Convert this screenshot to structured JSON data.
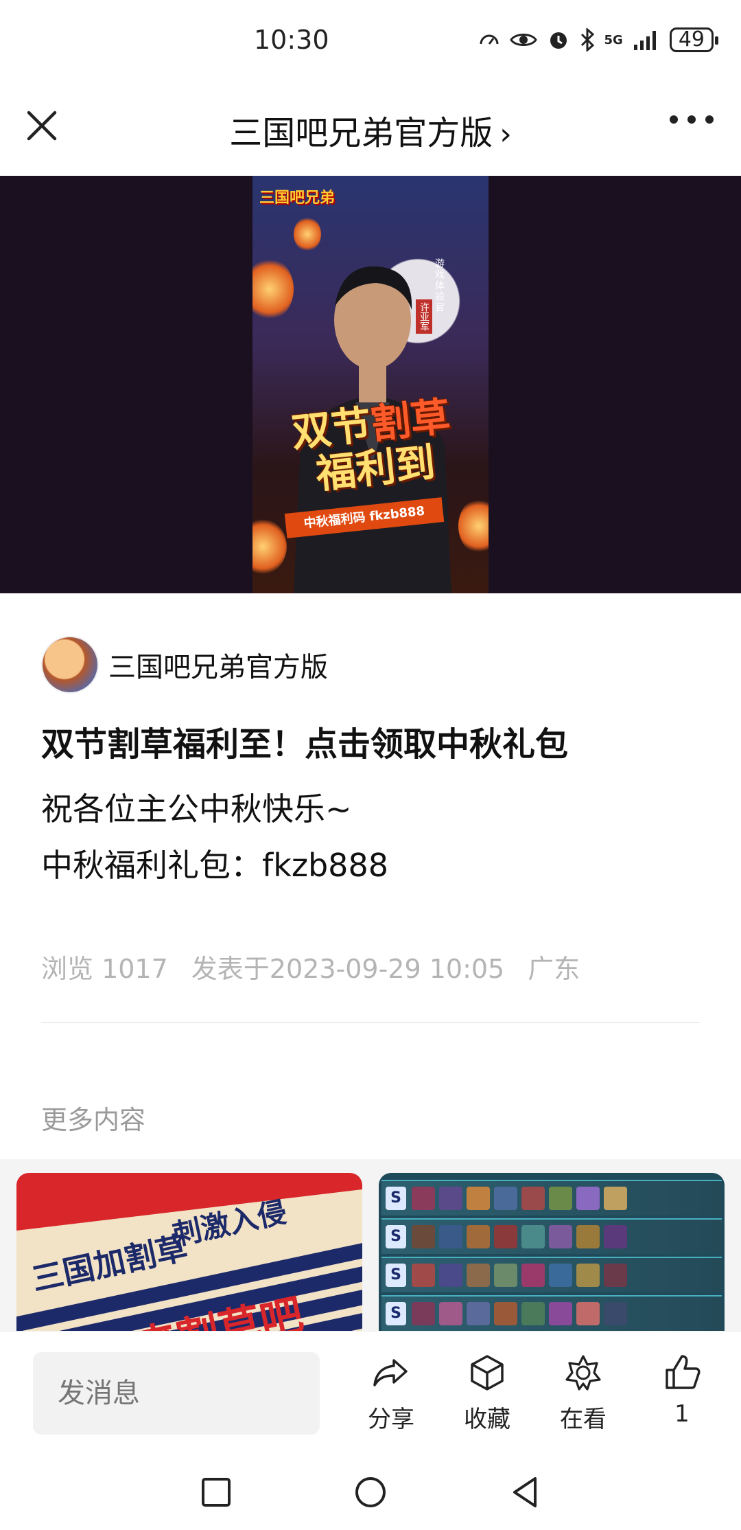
{
  "status_bar": {
    "time": "10:30",
    "network": "5G",
    "battery": "49",
    "icons": [
      "speed-icon",
      "eye-icon",
      "alarm-icon",
      "bluetooth-icon",
      "signal-icon",
      "battery-icon"
    ]
  },
  "nav": {
    "title": "三国吧兄弟官方版",
    "chevron": "›",
    "close_icon": "close-icon",
    "more_icon": "more-icon"
  },
  "banner": {
    "logo": "三国吧兄弟",
    "vertical_title": "游戏体验官",
    "vertical_name": "许亚军",
    "headline_part1": "双节",
    "headline_part2": "割草",
    "headline_line2": "福利到",
    "code_strip": "中秋福利码 fkzb888"
  },
  "article": {
    "author": "三国吧兄弟官方版",
    "title": "双节割草福利至！点击领取中秋礼包",
    "body_line1": "祝各位主公中秋快乐~",
    "body_line2": "中秋福利礼包：fkzb888",
    "meta_views": "浏览 1017",
    "meta_date": "发表于2023-09-29 10:05",
    "meta_region": "广东"
  },
  "more": {
    "title": "更多内容",
    "card1": {
      "text1": "三国加割草",
      "text2": "刺激入侵",
      "text3": "来割草吧"
    },
    "card2": {
      "tier_labels": [
        "S",
        "S",
        "S",
        "S"
      ]
    }
  },
  "bottom_bar": {
    "input_placeholder": "发消息",
    "share_label": "分享",
    "favorite_label": "收藏",
    "watching_label": "在看",
    "like_count": "1"
  },
  "colors": {
    "banner_bg": "#1a1020",
    "meta_gray": "#b4b4b4",
    "input_bg": "#f2f2f2"
  }
}
